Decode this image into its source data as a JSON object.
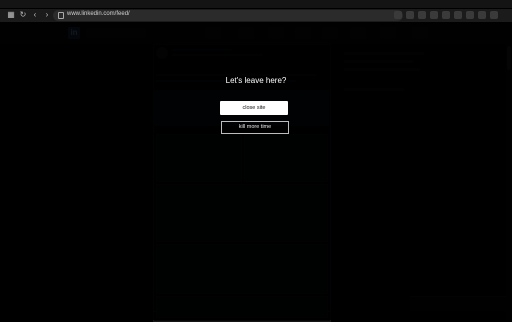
{
  "browser": {
    "url": "www.linkedin.com/feed/",
    "nav_back": "‹",
    "nav_forward": "›",
    "nav_reload": "↻"
  },
  "modal": {
    "title": "Let's leave here?",
    "primary_button": "close site",
    "secondary_button": "kill more time"
  },
  "linkedin": {
    "logo_text": "in"
  }
}
